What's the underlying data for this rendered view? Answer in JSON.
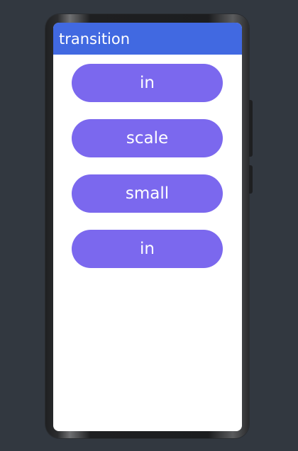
{
  "appbar": {
    "title": "transition"
  },
  "buttons": [
    {
      "label": "in"
    },
    {
      "label": "scale"
    },
    {
      "label": "small"
    },
    {
      "label": "in"
    }
  ],
  "colors": {
    "appbar": "#4169e1",
    "button": "#7b68ee",
    "background": "#323840"
  }
}
